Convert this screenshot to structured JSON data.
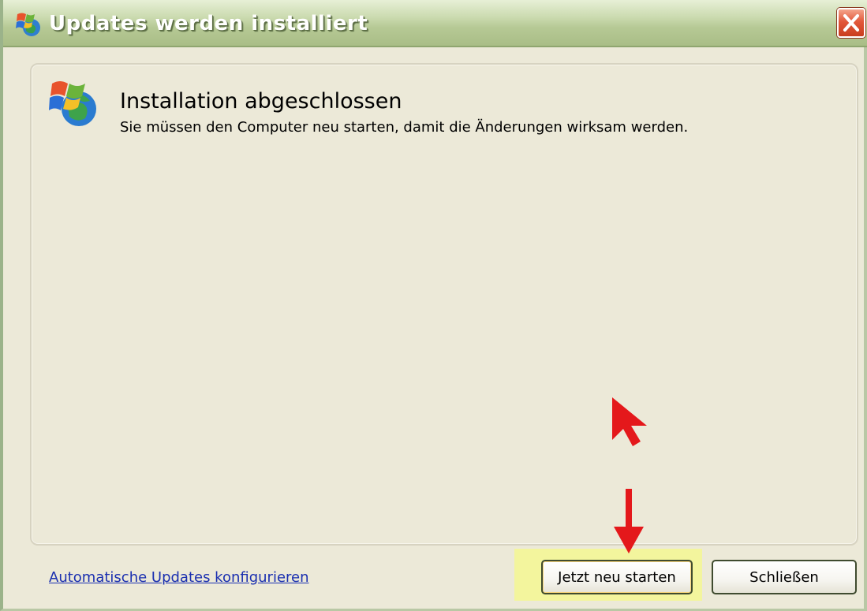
{
  "window": {
    "title": "Updates werden installiert",
    "close_icon": "close-icon"
  },
  "main": {
    "heading": "Installation abgeschlossen",
    "message": "Sie müssen den Computer neu starten, damit die Änderungen wirksam werden.",
    "logo_icon": "windows-update-icon"
  },
  "footer": {
    "link_label": "Automatische Updates konfigurieren",
    "restart_label": "Jetzt neu starten",
    "close_label": "Schließen"
  },
  "annotations": {
    "highlight_color": "#f3f59d",
    "arrow_color": "#e4181b"
  }
}
